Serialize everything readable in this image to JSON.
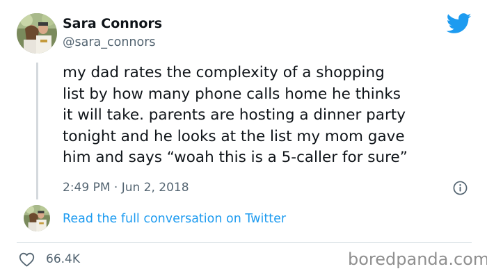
{
  "author": {
    "display_name": "Sara Connors",
    "handle": "@sara_connors"
  },
  "tweet": {
    "text_lines": [
      "my dad rates the complexity of a shopping",
      "list by how many phone calls home he thinks",
      "it will take. parents are hosting a dinner party",
      "tonight and he looks at the list my mom gave",
      "him and says “woah this is a 5-caller for sure”"
    ],
    "timestamp": "2:49 PM · Jun 2, 2018"
  },
  "conversation_link": "Read the full conversation on Twitter",
  "engagement": {
    "likes": "66.4K"
  },
  "watermark": "boredpanda.com",
  "icons": {
    "brand": "twitter-bird-icon",
    "info": "info-icon",
    "like": "heart-icon"
  },
  "colors": {
    "twitter_blue": "#1d9bf0",
    "text_primary": "#0f1419",
    "text_secondary": "#536471",
    "thread_line": "#d4d9dd",
    "divider": "#cfd9de",
    "watermark": "#8f8f8f"
  }
}
